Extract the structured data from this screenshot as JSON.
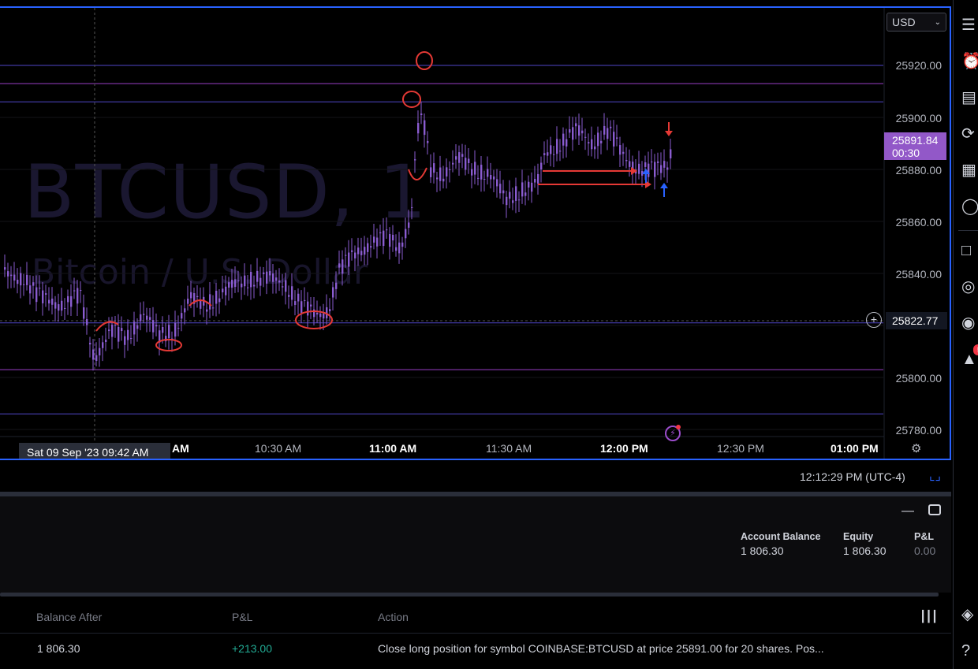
{
  "chart": {
    "symbol_watermark": "BTCUSD, 1",
    "description_watermark": "Bitcoin / U.S. Dollar",
    "currency": "USD",
    "price_axis": [
      "25920.00",
      "25900.00",
      "25880.00",
      "25860.00",
      "25840.00",
      "25800.00",
      "25780.00"
    ],
    "current_price": "25891.84",
    "countdown": "00:30",
    "crosshair_price": "25822.77",
    "time_axis": [
      {
        "label": "AM",
        "bold": true
      },
      {
        "label": "10:30 AM",
        "bold": false
      },
      {
        "label": "11:00 AM",
        "bold": true
      },
      {
        "label": "11:30 AM",
        "bold": false
      },
      {
        "label": "12:00 PM",
        "bold": true
      },
      {
        "label": "12:30 PM",
        "bold": false
      },
      {
        "label": "01:00 PM",
        "bold": true
      }
    ],
    "crosshair_date": "Sat 09 Sep '23   09:42 AM",
    "colors": {
      "candle": "#8a5cd0",
      "hline": "#5046c8",
      "hline_alt": "#9a3fc8",
      "annotation": "#e53935",
      "up_arrow": "#2962ff",
      "accent": "#2962ff"
    }
  },
  "status": {
    "time": "12:12:29 PM (UTC-4)"
  },
  "account": {
    "balance_label": "Account Balance",
    "balance_value": "1 806.30",
    "equity_label": "Equity",
    "equity_value": "1 806.30",
    "pnl_label": "P&L",
    "pnl_value": "0.00"
  },
  "history": {
    "headers": {
      "balance_after": "Balance After",
      "pnl": "P&L",
      "action": "Action"
    },
    "rows": [
      {
        "balance_after": "1 806.30",
        "pnl": "+213.00",
        "action": "Close long position for symbol COINBASE:BTCUSD at price 25891.00 for 20 shares. Pos..."
      }
    ]
  },
  "toolbar": {
    "icons": [
      "watchlist-icon",
      "alarm-icon",
      "data-window-icon",
      "hotlist-icon",
      "calendar-icon",
      "ideas-icon",
      "chat-icon",
      "streams-icon",
      "broadcast-icon",
      "notifications-icon",
      "layers-icon",
      "help-icon"
    ],
    "notification_badge": "!"
  }
}
